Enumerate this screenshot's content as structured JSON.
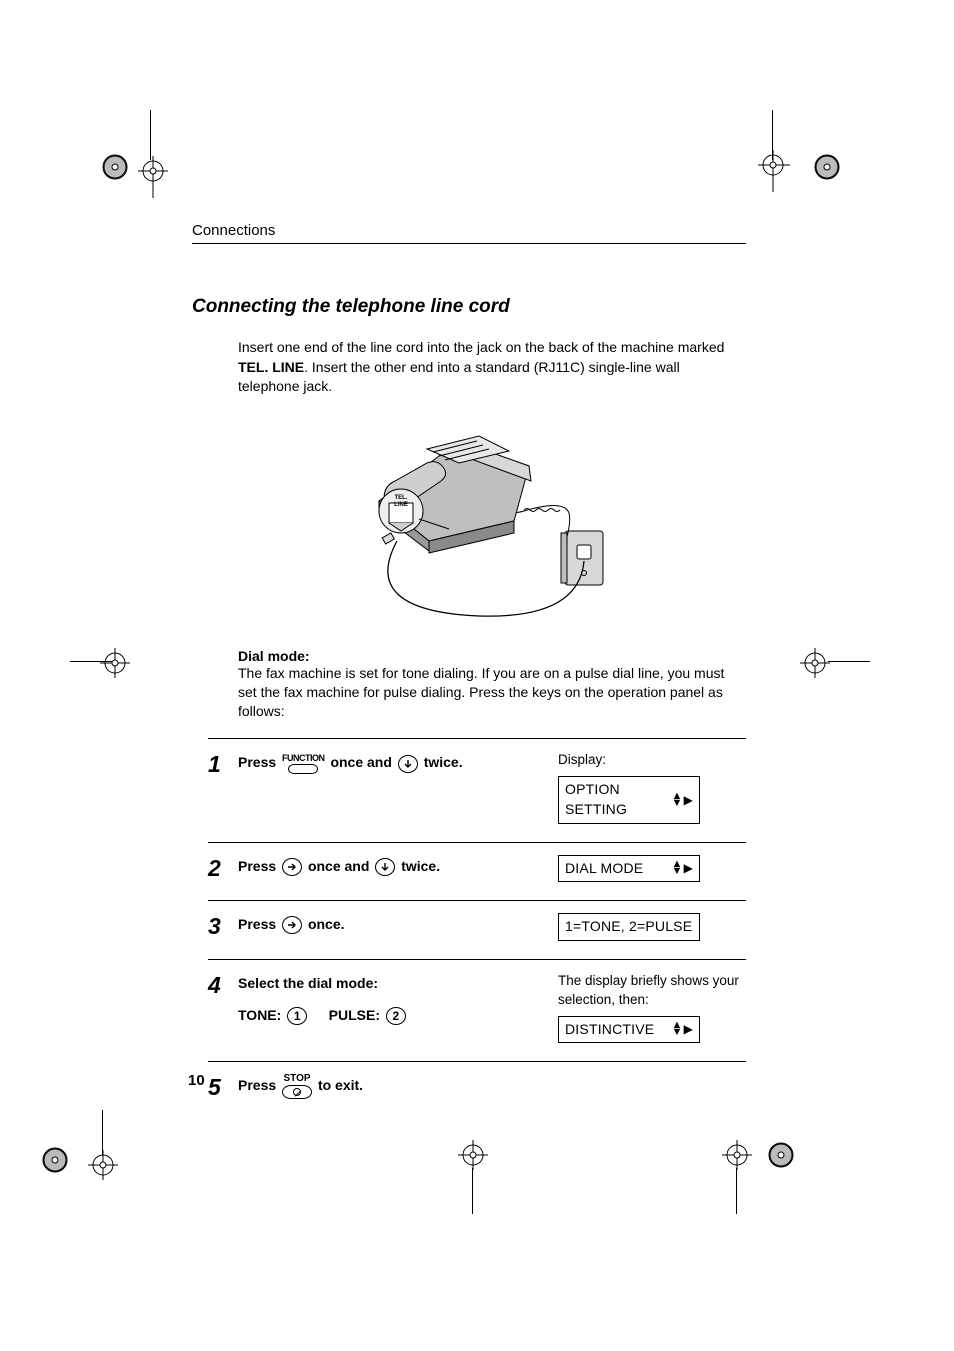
{
  "header": {
    "section": "Connections"
  },
  "title": "Connecting the telephone line cord",
  "intro": {
    "p1a": "Insert one end of the line cord into the jack on the back of the machine marked ",
    "bold": "TEL. LINE",
    "p1b": ". Insert the other end into a standard (RJ11C) single-line wall telephone jack."
  },
  "illustration": {
    "port_label": "TEL.\nLINE"
  },
  "dial": {
    "heading": "Dial mode:",
    "body": "The fax machine is set for tone dialing. If you are on a pulse dial line, you must set the fax machine for pulse dialing. Press the keys on the operation panel as follows:"
  },
  "keys": {
    "function": "FUNCTION",
    "stop": "STOP",
    "one": "1",
    "two": "2"
  },
  "steps": [
    {
      "n": "1",
      "pressA": "Press ",
      "mid": " once and ",
      "tail": " twice.",
      "right_label": "Display:",
      "lcd": "OPTION SETTING"
    },
    {
      "n": "2",
      "pressA": "Press ",
      "mid": " once and ",
      "tail": " twice.",
      "lcd": "DIAL MODE"
    },
    {
      "n": "3",
      "pressA": "Press ",
      "tail": " once.",
      "lcd": "1=TONE, 2=PULSE"
    },
    {
      "n": "4",
      "line1": "Select the dial mode:",
      "tone_label": "TONE: ",
      "pulse_label": "PULSE: ",
      "right_label": "The display briefly shows your selection, then:",
      "lcd": "DISTINCTIVE"
    },
    {
      "n": "5",
      "pressA": "Press ",
      "tail": " to exit."
    }
  ],
  "page_number": "10"
}
